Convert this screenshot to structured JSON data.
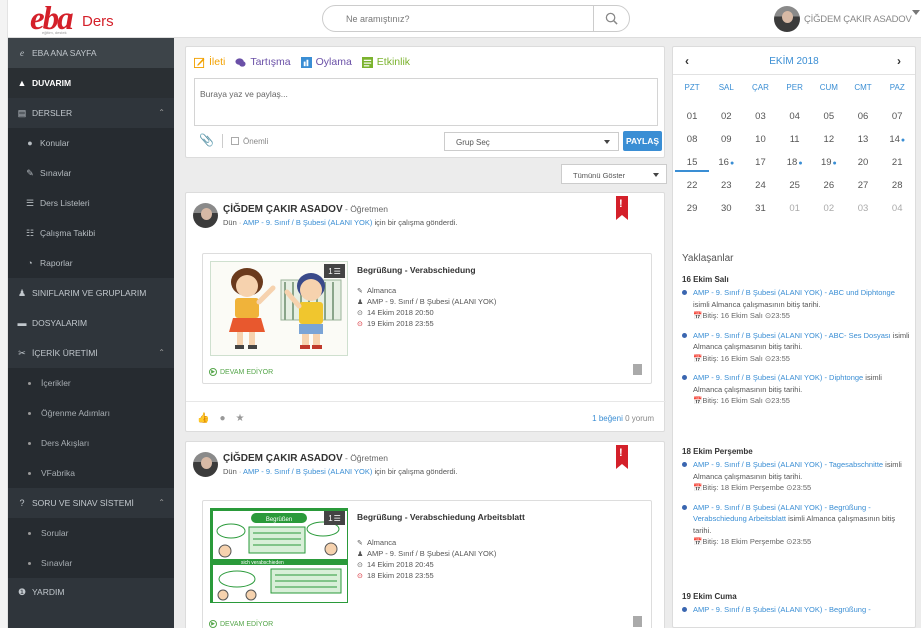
{
  "brand": {
    "logo": "eba",
    "product": "Ders",
    "tagline": "eğitim, destek"
  },
  "search": {
    "placeholder": "Ne aramıştınız?"
  },
  "user": {
    "name": "ÇİĞDEM ÇAKIR ASADOV"
  },
  "sidebar": {
    "items": [
      {
        "label": "EBA ANA SAYFA",
        "icon": "eba-icon"
      },
      {
        "label": "DUVARIM",
        "icon": "wall-icon"
      },
      {
        "label": "DERSLER",
        "icon": "book-icon"
      },
      {
        "label": "Konular",
        "icon": "topics-icon"
      },
      {
        "label": "Sınavlar",
        "icon": "pencil-icon"
      },
      {
        "label": "Ders Listeleri",
        "icon": "list-icon"
      },
      {
        "label": "Çalışma Takibi",
        "icon": "tracking-icon"
      },
      {
        "label": "Raporlar",
        "icon": "reports-icon"
      },
      {
        "label": "SINIFLARIM VE GRUPLARIM",
        "icon": "group-icon"
      },
      {
        "label": "DOSYALARIM",
        "icon": "folder-icon"
      },
      {
        "label": "İÇERİK ÜRETİMİ",
        "icon": "content-icon"
      },
      {
        "label": "İçerikler"
      },
      {
        "label": "Öğrenme Adımları"
      },
      {
        "label": "Ders Akışları"
      },
      {
        "label": "VFabrika"
      },
      {
        "label": "SORU VE SINAV SİSTEMİ",
        "icon": "quiz-icon"
      },
      {
        "label": "Sorular"
      },
      {
        "label": "Sınavlar"
      },
      {
        "label": "YARDIM",
        "icon": "help-icon"
      }
    ]
  },
  "composer": {
    "tabs": [
      "İleti",
      "Tartışma",
      "Oylama",
      "Etkinlik"
    ],
    "placeholder": "Buraya yaz ve paylaş...",
    "important_label": "Önemli",
    "group_select": "Grup Seç",
    "share_button": "PAYLAŞ"
  },
  "filter": {
    "label": "Tümünü Göster"
  },
  "posts": [
    {
      "author": "ÇİĞDEM ÇAKIR ASADOV",
      "role": " - Öğretmen",
      "when": "Dün",
      "dot": "·",
      "target": "AMP - 9. Sınıf / B Şubesi (ALANI YOK)",
      "action": " için bir çalışma gönderdi.",
      "badge": "1",
      "title": "Begrüßung - Verabschiedung",
      "subject": "Almanca",
      "group": "AMP - 9. Sınıf / B Şubesi (ALANI YOK)",
      "start": "14 Ekim 2018 20:50",
      "end": "19 Ekim 2018 23:55",
      "status": "DEVAM EDİYOR",
      "likes": "1 beğeni",
      "comments": "0 yorum"
    },
    {
      "author": "ÇİĞDEM ÇAKIR ASADOV",
      "role": " - Öğretmen",
      "when": "Dün",
      "dot": "·",
      "target": "AMP - 9. Sınıf / B Şubesi (ALANI YOK)",
      "action": " için bir çalışma gönderdi.",
      "badge": "1",
      "title": "Begrüßung - Verabschiedung Arbeitsblatt",
      "subject": "Almanca",
      "group": "AMP - 9. Sınıf / B Şubesi (ALANI YOK)",
      "start": "14 Ekim 2018 20:45",
      "end": "18 Ekim 2018 23:55",
      "status": "DEVAM EDİYOR",
      "thumb_title": "Begrüßen",
      "thumb_label": "sich verabschieden"
    }
  ],
  "calendar": {
    "month": "EKİM 2018",
    "prev": "‹",
    "next": "›",
    "days": [
      "PZT",
      "SAL",
      "ÇAR",
      "PER",
      "CUM",
      "CMT",
      "PAZ"
    ],
    "weeks": [
      [
        "01",
        "02",
        "03",
        "04",
        "05",
        "06",
        "07"
      ],
      [
        "08",
        "09",
        "10",
        "11",
        "12",
        "13",
        "14"
      ],
      [
        "15",
        "16",
        "17",
        "18",
        "19",
        "20",
        "21"
      ],
      [
        "22",
        "23",
        "24",
        "25",
        "26",
        "27",
        "28"
      ],
      [
        "29",
        "30",
        "31",
        "01",
        "02",
        "03",
        "04"
      ]
    ],
    "event_marks": [
      "14",
      "16",
      "18",
      "19"
    ],
    "today": "15"
  },
  "upcoming": {
    "title": "Yaklaşanlar",
    "groups": [
      {
        "date": "16 Ekim Salı",
        "events": [
          {
            "link": "AMP - 9. Sınıf / B Şubesi (ALANI YOK) - ABC und Diphtonge",
            "text": " isimli Almanca çalışmasının bitiş tarihi.",
            "due": "📅Bitiş: 16 Ekim Salı  ⊙23:55"
          },
          {
            "link": "AMP - 9. Sınıf / B Şubesi (ALANI YOK) - ABC- Ses Dosyası",
            "text": " isimli Almanca çalışmasının bitiş tarihi.",
            "due": "📅Bitiş: 16 Ekim Salı  ⊙23:55"
          },
          {
            "link": "AMP - 9. Sınıf / B Şubesi (ALANI YOK) - Diphtonge",
            "text": " isimli Almanca çalışmasının bitiş tarihi.",
            "due": "📅Bitiş: 16 Ekim Salı  ⊙23:55"
          }
        ]
      },
      {
        "date": "18 Ekim Perşembe",
        "events": [
          {
            "link": "AMP - 9. Sınıf / B Şubesi (ALANI YOK) - Tagesabschnitte",
            "text": " isimli Almanca çalışmasının bitiş tarihi.",
            "due": "📅Bitiş: 18 Ekim Perşembe  ⊙23:55"
          },
          {
            "link": "AMP - 9. Sınıf / B Şubesi (ALANI YOK) - Begrüßung - Verabschiedung Arbeitsblatt",
            "text": " isimli Almanca çalışmasının bitiş tarihi.",
            "due": "📅Bitiş: 18 Ekim Perşembe  ⊙23:55"
          }
        ]
      },
      {
        "date": "19 Ekim Cuma",
        "events": [
          {
            "link": "AMP - 9. Sınıf / B Şubesi (ALANI YOK) - Begrüßung -",
            "text": "",
            "due": ""
          }
        ]
      }
    ]
  },
  "colors": {
    "brand_red": "#d4202a",
    "link_blue": "#3a8ed4",
    "sidebar_bg": "#2f353b",
    "tab_orange": "#f2a100",
    "tab_purple": "#6a50a7",
    "tab_green": "#7bb32e"
  }
}
